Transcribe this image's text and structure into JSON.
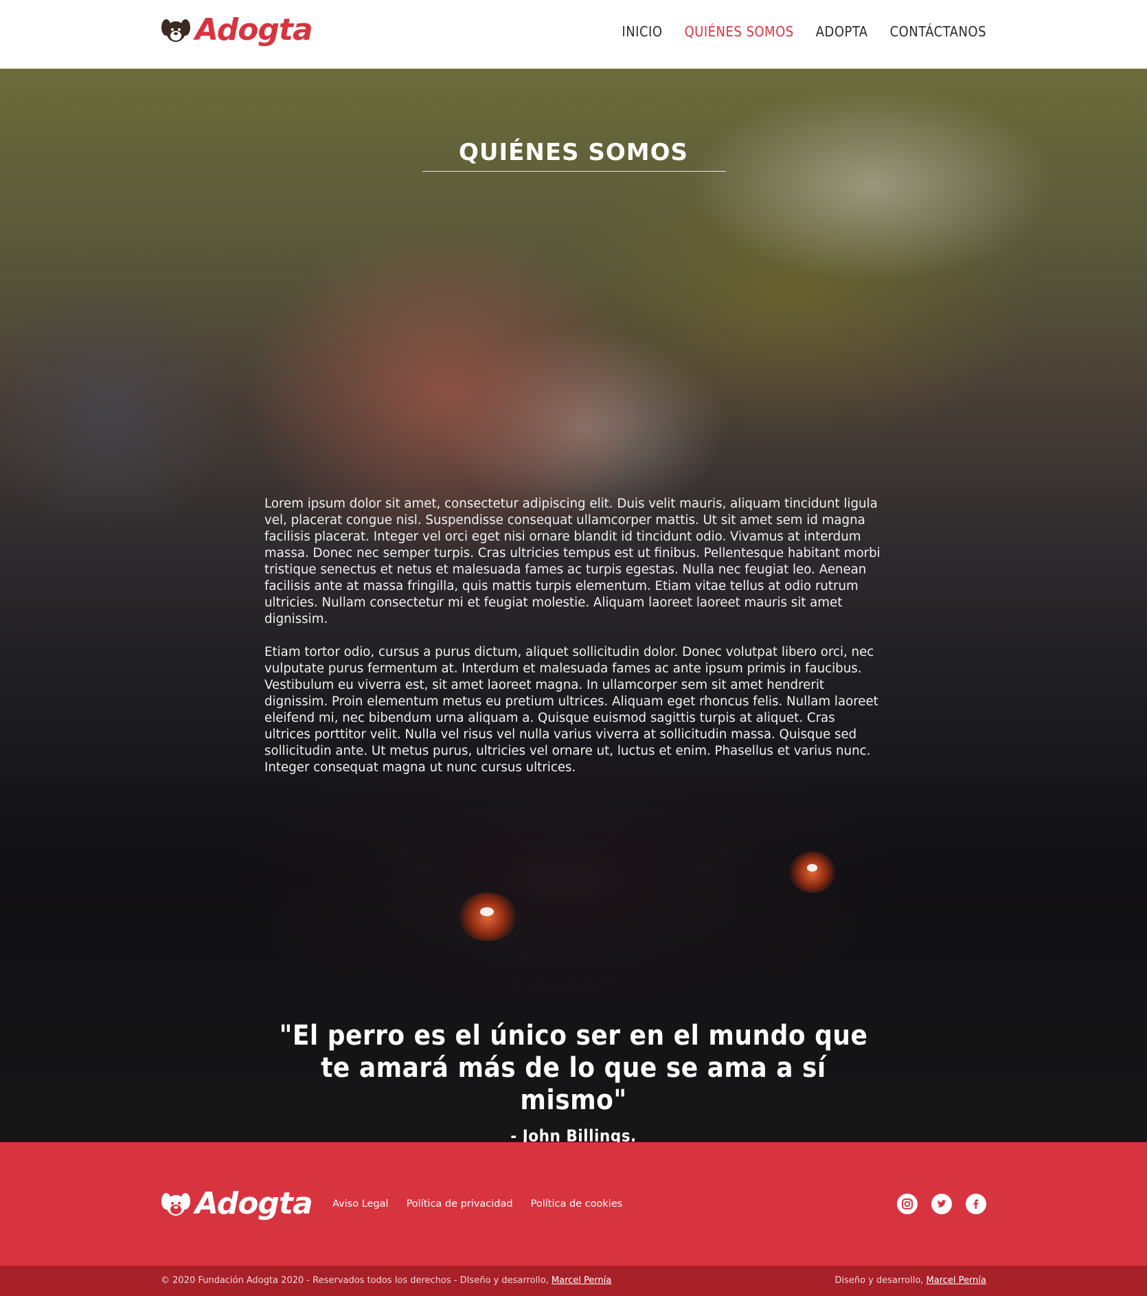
{
  "header": {
    "brand": "Adogta",
    "nav": [
      {
        "label": "INICIO",
        "active": false
      },
      {
        "label": "QUIÉNES SOMOS",
        "active": true
      },
      {
        "label": "ADOPTA",
        "active": false
      },
      {
        "label": "CONTÁCTANOS",
        "active": false
      }
    ]
  },
  "colors": {
    "brand_red": "#d8343f",
    "bottom_bar": "#a82129",
    "dark_bg": "#171717"
  },
  "hero": {
    "title": "QUIÉNES SOMOS",
    "paragraphs": [
      "Lorem ipsum dolor sit amet, consectetur adipiscing elit. Duis velit mauris, aliquam tincidunt ligula vel, placerat congue nisl. Suspendisse consequat ullamcorper mattis. Ut sit amet sem id magna facilisis placerat. Integer vel orci eget nisi ornare blandit id tincidunt odio. Vivamus at interdum massa. Donec nec semper turpis. Cras ultricies tempus est ut finibus. Pellentesque habitant morbi tristique senectus et netus et malesuada fames ac turpis egestas. Nulla nec feugiat leo. Aenean facilisis ante at massa fringilla, quis mattis turpis elementum. Etiam vitae tellus at odio rutrum ultricies. Nullam consectetur mi et feugiat molestie. Aliquam laoreet laoreet mauris sit amet dignissim.",
      "Etiam tortor odio, cursus a purus dictum, aliquet sollicitudin dolor. Donec volutpat libero orci, nec vulputate purus fermentum at. Interdum et malesuada fames ac ante ipsum primis in faucibus. Vestibulum eu viverra est, sit amet laoreet magna. In ullamcorper sem sit amet hendrerit dignissim. Proin elementum metus eu pretium ultrices. Aliquam eget rhoncus felis. Nullam laoreet eleifend mi, nec bibendum urna aliquam a. Quisque euismod sagittis turpis at aliquet. Cras ultrices porttitor velit. Nulla vel risus vel nulla varius viverra at sollicitudin massa. Quisque sed sollicitudin ante. Ut metus purus, ultricies vel ornare ut, luctus et enim. Phasellus et varius nunc. Integer consequat magna ut nunc cursus ultrices."
    ],
    "quote": "\"El perro es el único ser en el mundo que te amará más de lo que se ama a sí mismo\"",
    "quote_author": "- John Billings."
  },
  "footer": {
    "brand": "Adogta",
    "links": [
      "Aviso Legal",
      "Política de privacidad",
      "Política de cookies"
    ],
    "socials": [
      "instagram-icon",
      "twitter-icon",
      "facebook-icon"
    ],
    "copyright_prefix": "© 2020 Fundación Adogta 2020 - Reservados todos los derechos - DIseño y desarrollo, ",
    "copyright_author": "Marcel Pernía",
    "credit_prefix": "Diseño y desarrollo, ",
    "credit_author": "Marcel Pernía"
  }
}
